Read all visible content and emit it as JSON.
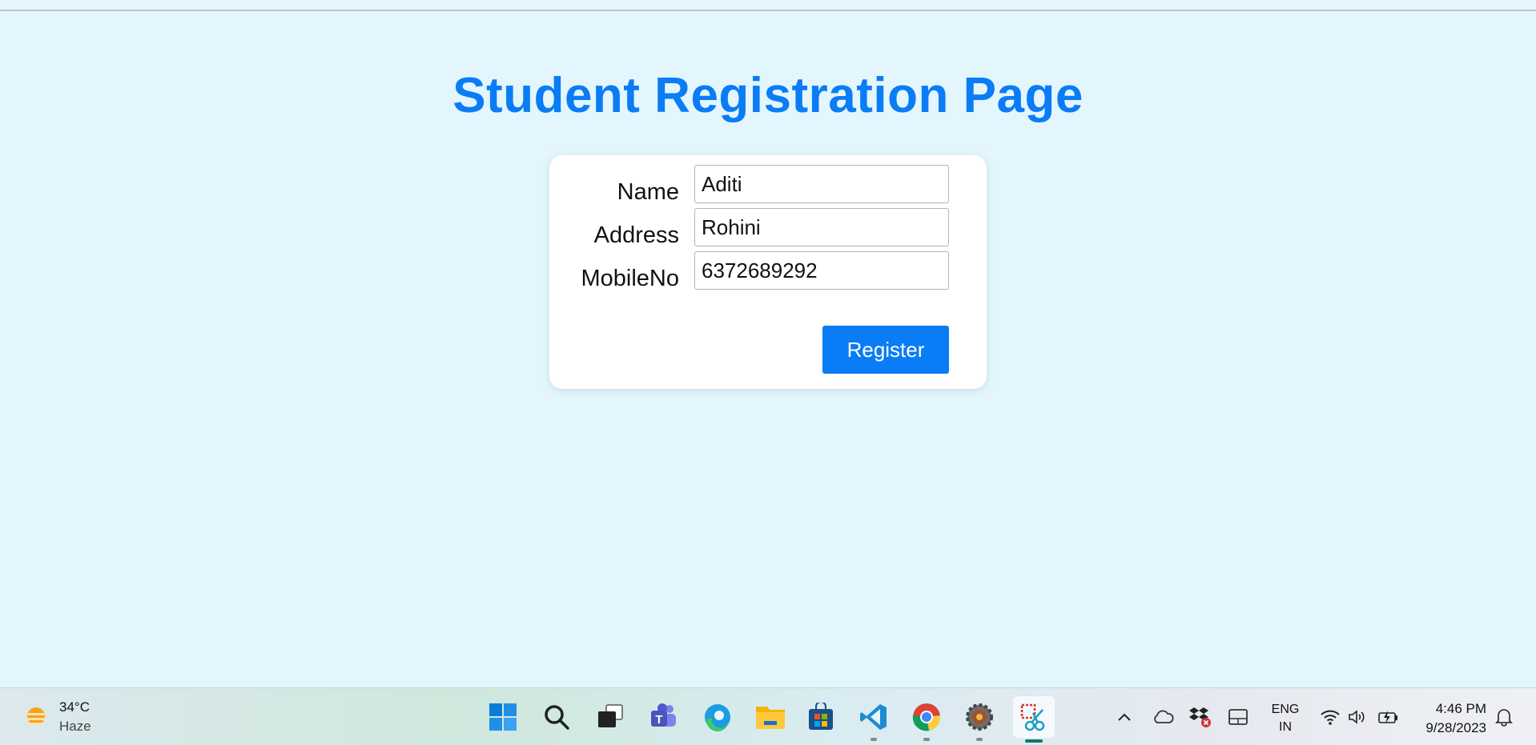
{
  "page": {
    "title": "Student Registration Page"
  },
  "form": {
    "fields": [
      {
        "label": "Name",
        "value": "Aditi"
      },
      {
        "label": "Address",
        "value": "Rohini"
      },
      {
        "label": "MobileNo",
        "value": "6372689292"
      }
    ],
    "submit_label": "Register"
  },
  "taskbar": {
    "weather": {
      "temp": "34°C",
      "condition": "Haze",
      "icon": "sun-haze-icon"
    },
    "apps": [
      {
        "name": "start-icon"
      },
      {
        "name": "search-icon"
      },
      {
        "name": "task-view-icon"
      },
      {
        "name": "teams-icon"
      },
      {
        "name": "edge-icon"
      },
      {
        "name": "file-explorer-icon"
      },
      {
        "name": "microsoft-store-icon"
      },
      {
        "name": "vscode-icon"
      },
      {
        "name": "chrome-icon"
      },
      {
        "name": "gear-app-icon"
      },
      {
        "name": "snipping-tool-icon"
      }
    ],
    "tray": {
      "language_line1": "ENG",
      "language_line2": "IN",
      "time": "4:46 PM",
      "date": "9/28/2023"
    }
  },
  "colors": {
    "page_bg": "#e3f6fd",
    "accent": "#0a7cf5",
    "card_bg": "#ffffff"
  }
}
